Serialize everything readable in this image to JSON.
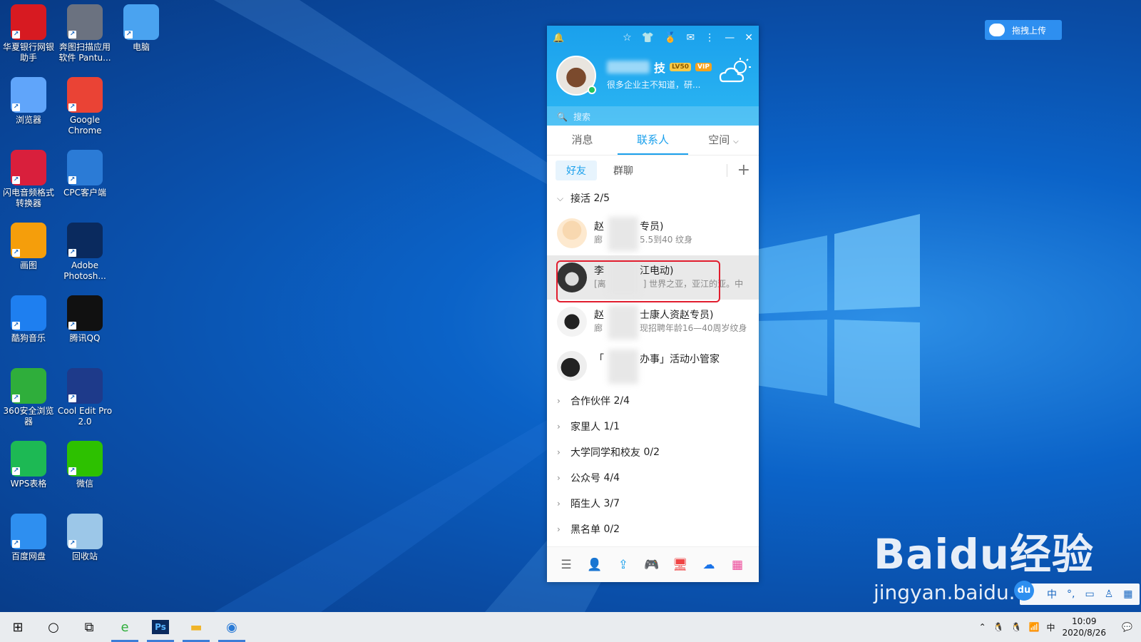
{
  "desktop": {
    "icons": [
      {
        "label": "华夏银行网银助手",
        "icon": "huaxia-bank-icon",
        "color": "#d71a21"
      },
      {
        "label": "奔图扫描应用软件 Pantu...",
        "icon": "scanner-icon",
        "color": "#6b7280"
      },
      {
        "label": "电脑",
        "icon": "computer-icon",
        "color": "#4aa3f0"
      },
      {
        "label": "浏览器",
        "icon": "browser-icon",
        "color": "#60a5fa"
      },
      {
        "label": "Google Chrome",
        "icon": "chrome-icon",
        "color": "#ea4335"
      },
      {
        "label": "闪电音频格式转换器",
        "icon": "audio-converter-icon",
        "color": "#d91f3c"
      },
      {
        "label": "CPC客户端",
        "icon": "cpc-client-icon",
        "color": "#2b7bd6"
      },
      {
        "label": "画图",
        "icon": "paint-icon",
        "color": "#f59e0b"
      },
      {
        "label": "Adobe Photosh...",
        "icon": "photoshop-icon",
        "color": "#0a2a5e"
      },
      {
        "label": "酷狗音乐",
        "icon": "kugou-icon",
        "color": "#1e7ff0"
      },
      {
        "label": "腾讯QQ",
        "icon": "qq-icon",
        "color": "#111111"
      },
      {
        "label": "360安全浏览器",
        "icon": "360-browser-icon",
        "color": "#2fae3b"
      },
      {
        "label": "Cool Edit Pro 2.0",
        "icon": "cool-edit-icon",
        "color": "#1e3a8a"
      },
      {
        "label": "WPS表格",
        "icon": "wps-sheet-icon",
        "color": "#1db954"
      },
      {
        "label": "微信",
        "icon": "wechat-icon",
        "color": "#2dc100"
      },
      {
        "label": "百度网盘",
        "icon": "baidu-netdisk-icon",
        "color": "#2e8ff0"
      },
      {
        "label": "回收站",
        "icon": "recycle-bin-icon",
        "color": "#9cc7e8"
      }
    ]
  },
  "qq": {
    "nickname_tail": "技",
    "level_badge": "LV50",
    "vip_badge": "VIP",
    "signature": "很多企业主不知道，研...",
    "search_placeholder": "搜索",
    "tabs": [
      "消息",
      "联系人",
      "空间"
    ],
    "active_tab": "联系人",
    "subtabs": [
      "好友",
      "群聊"
    ],
    "plus": "+",
    "expanded_group": {
      "label": "接活",
      "count": "2/5"
    },
    "contacts": [
      {
        "name": "赵",
        "name_tail": "专员)",
        "msg": "廊",
        "msg_tail": "5.5到40  纹身",
        "avatar": "cartoon-avatar"
      },
      {
        "name": "李",
        "name_tail": "江电动)",
        "msg": "[离",
        "msg_tail": "]  世界之亚，亚江的亚。中",
        "avatar": "car-avatar"
      },
      {
        "name": "赵",
        "name_tail": "士康人资赵专员)",
        "msg": "廊",
        "msg_tail": "现招聘年龄16—40周岁纹身",
        "avatar": "penguin-avatar"
      },
      {
        "name": "「",
        "name_tail": "办事」活动小管家",
        "msg": "",
        "msg_tail": "",
        "avatar": "qq-manager-avatar"
      }
    ],
    "groups": [
      {
        "label": "合作伙伴",
        "count": "2/4"
      },
      {
        "label": "家里人",
        "count": "1/1"
      },
      {
        "label": "大学同学和校友",
        "count": "0/2"
      },
      {
        "label": "公众号",
        "count": "4/4"
      },
      {
        "label": "陌生人",
        "count": "3/7"
      },
      {
        "label": "黑名单",
        "count": "0/2"
      }
    ]
  },
  "upload_button": "拖拽上传",
  "watermark": {
    "brand": "Bai",
    "brand_du": "du",
    "brand_cn": "经验",
    "url": "jingyan.baidu.com"
  },
  "ime": {
    "du": "du",
    "lang": "中"
  },
  "taskbar": {
    "time": "10:09",
    "date": "2020/8/26",
    "tray_lang": "中"
  },
  "colors": {
    "accent": "#1aa0ec",
    "highlight_box": "#e11d2e"
  }
}
